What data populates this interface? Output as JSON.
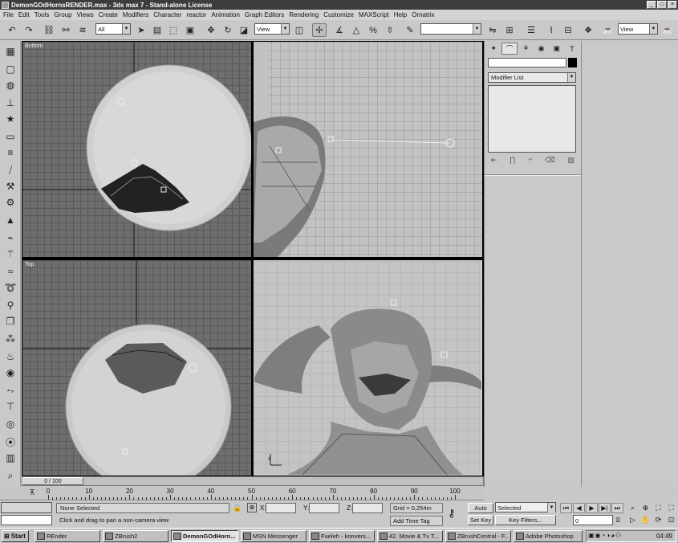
{
  "window": {
    "title": "DemonGOdHornsRENDER.max - 3ds max 7 - Stand-alone License",
    "min": "_",
    "max": "□",
    "close": "×"
  },
  "menu": [
    "File",
    "Edit",
    "Tools",
    "Group",
    "Views",
    "Create",
    "Modifiers",
    "Character",
    "reactor",
    "Animation",
    "Graph Editors",
    "Rendering",
    "Customize",
    "MAXScript",
    "Help",
    "Ornatrix"
  ],
  "toolbar": {
    "selection_filter": "All",
    "ref_coord": "View",
    "named_selection": "",
    "viewport_layout": "View"
  },
  "viewports": {
    "top_left": {
      "label": "Bottom"
    },
    "bottom_left": {
      "label": "Top"
    },
    "top_right": {
      "label": ""
    },
    "bottom_right": {
      "label": ""
    }
  },
  "command_panel": {
    "modifier_list": "Modifier List"
  },
  "time_slider": {
    "frame_label": "0 / 100"
  },
  "trackbar": {
    "ticks": [
      "0",
      "10",
      "20",
      "30",
      "40",
      "50",
      "60",
      "70",
      "80",
      "90",
      "100"
    ]
  },
  "status": {
    "selection": "None Selected",
    "prompt": "Click and drag to pan a non-camera view",
    "x_label": "X:",
    "y_label": "Y:",
    "z_label": "Z:",
    "grid": "Grid = 0,254m",
    "add_time_tag": "Add Time Tag",
    "auto_key": "Auto Key",
    "set_key": "Set Key",
    "selected": "Selected",
    "key_filters": "Key Filters...",
    "frame": "0"
  },
  "taskbar": {
    "start": "Start",
    "tasks": [
      "REnder",
      "ZBrush2",
      "DemonGOdHorn...",
      "MSN Messenger",
      "Fueleh - konvers...",
      "42. Movie & Tv T...",
      "ZBrushCentral - F...",
      "Adobe Photoshop"
    ],
    "clock": "04:49"
  }
}
